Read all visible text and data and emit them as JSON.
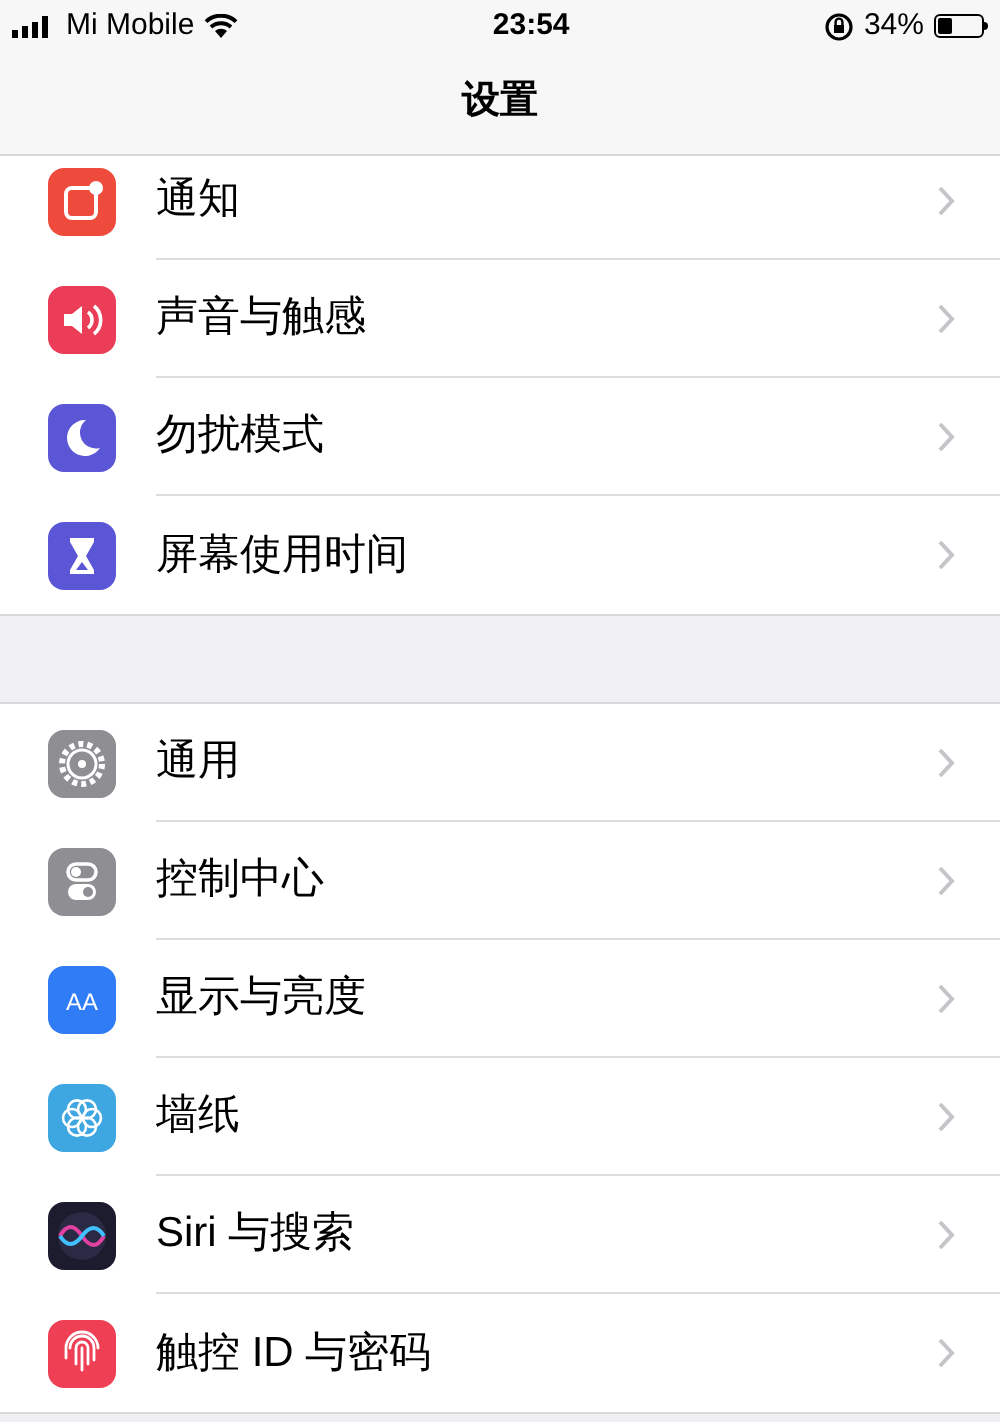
{
  "status_bar": {
    "carrier": "Mi Mobile",
    "time": "23:54",
    "battery": "34%"
  },
  "title": "设置",
  "groups": [
    {
      "items": [
        {
          "label": "通知",
          "kind": "notifications",
          "color": "#ee4b3c"
        },
        {
          "label": "声音与触感",
          "kind": "sound",
          "color": "#ec3d58"
        },
        {
          "label": "勿扰模式",
          "kind": "moon",
          "color": "#5b56d6"
        },
        {
          "label": "屏幕使用时间",
          "kind": "hourglass",
          "color": "#5b56d6"
        }
      ]
    },
    {
      "items": [
        {
          "label": "通用",
          "kind": "gear",
          "color": "#8e8e93"
        },
        {
          "label": "控制中心",
          "kind": "toggles",
          "color": "#8e8e93"
        },
        {
          "label": "显示与亮度",
          "kind": "text",
          "icon_text": "AA",
          "color": "#2f7cf6"
        },
        {
          "label": "墙纸",
          "kind": "flower",
          "color": "#3ea6e0"
        },
        {
          "label": "Siri 与搜索",
          "kind": "siri",
          "color": "#1c1c2e"
        },
        {
          "label": "触控 ID 与密码",
          "kind": "fingerprint",
          "color": "#ee3f55"
        }
      ]
    }
  ]
}
